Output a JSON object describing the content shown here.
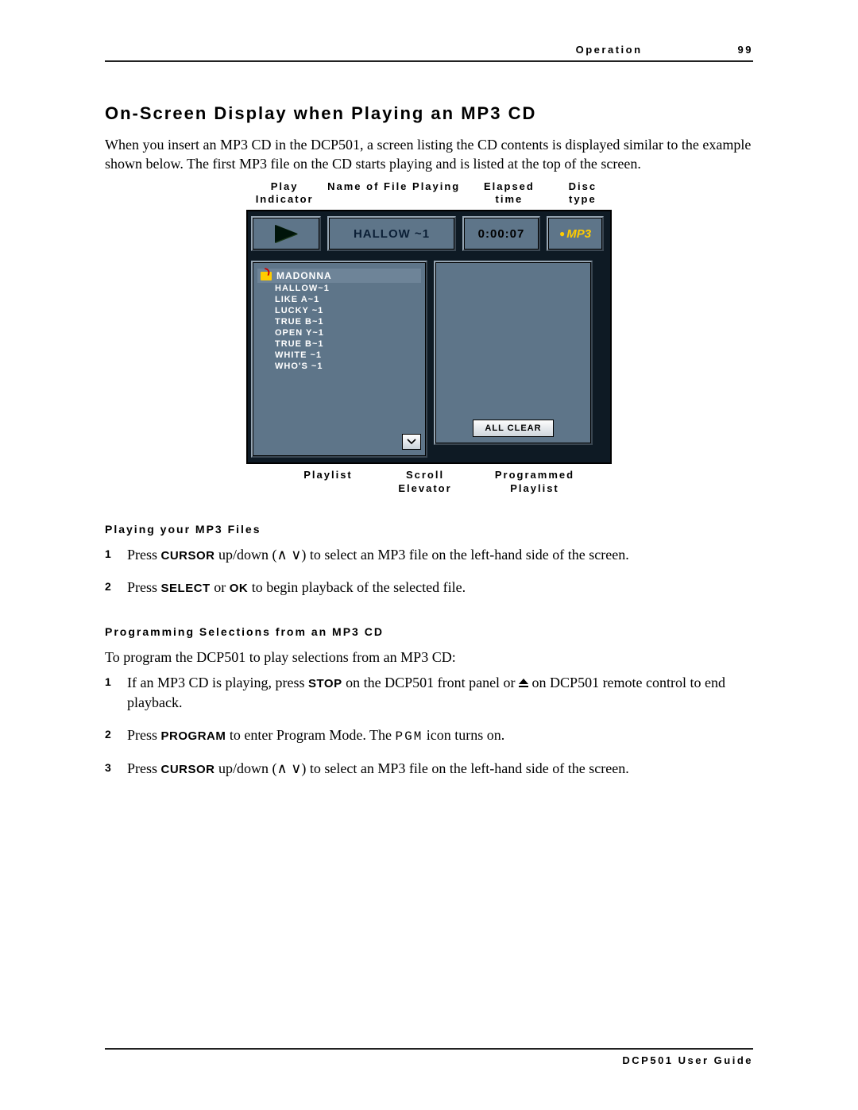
{
  "header": {
    "section": "Operation",
    "page_number": "99"
  },
  "footer": {
    "text": "DCP501 User Guide"
  },
  "h2": "On-Screen Display when Playing an MP3 CD",
  "intro": "When you insert an MP3 CD in the DCP501, a screen listing the CD contents is displayed similar to the example shown below. The first MP3 file on the CD starts playing and is listed at the top of the screen.",
  "fig_labels_top": {
    "play": "Play Indicator",
    "file": "Name of File Playing",
    "time": "Elapsed time",
    "type": "Disc type"
  },
  "fig_labels_bottom": {
    "playlist": "Playlist",
    "scroll": "Scroll Elevator",
    "prog": "Programmed Playlist"
  },
  "osd": {
    "now_playing": "HALLOW ~1",
    "elapsed": "0:00:07",
    "disc_type": "MP3",
    "folder": "MADONNA",
    "tracks": [
      "HALLOW~1",
      "LIKE A~1",
      "LUCKY ~1",
      "TRUE B~1",
      "OPEN Y~1",
      "TRUE B~1",
      "WHITE ~1",
      "WHO'S ~1"
    ],
    "all_clear": "ALL CLEAR"
  },
  "sub1": "Playing your MP3 Files",
  "play_steps": [
    {
      "num": "1",
      "pre": "Press ",
      "kbd1": "CURSOR",
      "mid": " up/down (∧ ∨) to select an MP3 file on the left-hand side of the screen."
    },
    {
      "num": "2",
      "pre": "Press ",
      "kbd1": "SELECT",
      "between": " or ",
      "kbd2": "OK",
      "mid": " to begin playback of the selected file."
    }
  ],
  "sub2": "Programming Selections from an MP3 CD",
  "prog_intro": "To program the DCP501 to play selections from an MP3 CD:",
  "prog_steps": [
    {
      "num": "1",
      "pre": "If an MP3 CD is playing, press ",
      "kbd1": "STOP",
      "mid": " on the DCP501 front panel or ",
      "eject": true,
      "after_eject": " on DCP501 remote control to end playback."
    },
    {
      "num": "2",
      "pre": "Press ",
      "kbd1": "PROGRAM",
      "mid": " to enter Program Mode. The ",
      "mono": "PGM",
      "after_mono": " icon turns on."
    },
    {
      "num": "3",
      "pre": "Press ",
      "kbd1": "CURSOR",
      "mid": " up/down (∧ ∨) to select an MP3 file on the left-hand side of the screen."
    }
  ]
}
